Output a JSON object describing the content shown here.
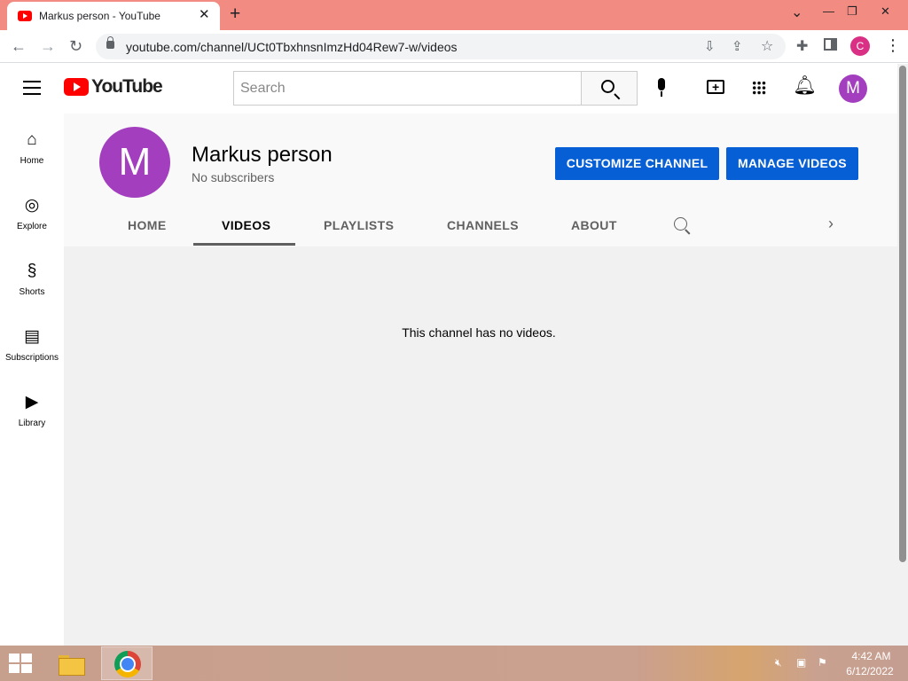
{
  "browser": {
    "tab_title": "Markus person - YouTube",
    "tab_close": "✕",
    "new_tab": "+",
    "window_controls": {
      "dropdown": "⌄",
      "minimize": "—",
      "restore": "❐",
      "close": "✕"
    },
    "nav": {
      "back": "←",
      "forward": "→",
      "reload": "↻"
    },
    "url": "youtube.com/channel/UCt0TbxhnsnImzHd04Rew7-w/videos",
    "omnibox_icons": [
      "install-icon",
      "share-icon",
      "star-icon"
    ],
    "toolbar_icons": [
      "extensions-icon",
      "side-panel-icon"
    ],
    "profile_initial": "C",
    "menu": "⋮"
  },
  "masthead": {
    "logo_text": "YouTube",
    "search_placeholder": "Search",
    "search_value": "",
    "avatar_initial": "M"
  },
  "guide": {
    "items": [
      {
        "label": "Home",
        "icon": "home-icon"
      },
      {
        "label": "Explore",
        "icon": "compass-icon"
      },
      {
        "label": "Shorts",
        "icon": "shorts-icon"
      },
      {
        "label": "Subscriptions",
        "icon": "subscriptions-icon"
      },
      {
        "label": "Library",
        "icon": "library-icon"
      }
    ]
  },
  "channel": {
    "avatar_initial": "M",
    "name": "Markus person",
    "subscribers": "No subscribers",
    "customize_label": "CUSTOMIZE CHANNEL",
    "manage_label": "MANAGE VIDEOS",
    "tabs": [
      "HOME",
      "VIDEOS",
      "PLAYLISTS",
      "CHANNELS",
      "ABOUT"
    ],
    "active_tab": "VIDEOS"
  },
  "content": {
    "empty_message": "This channel has no videos."
  },
  "taskbar": {
    "time": "4:42 AM",
    "date": "6/12/2022"
  },
  "colors": {
    "titlebar": "#f28b82",
    "button_blue": "#065fd4",
    "avatar_purple": "#a33fbf",
    "youtube_red": "#ff0000"
  }
}
